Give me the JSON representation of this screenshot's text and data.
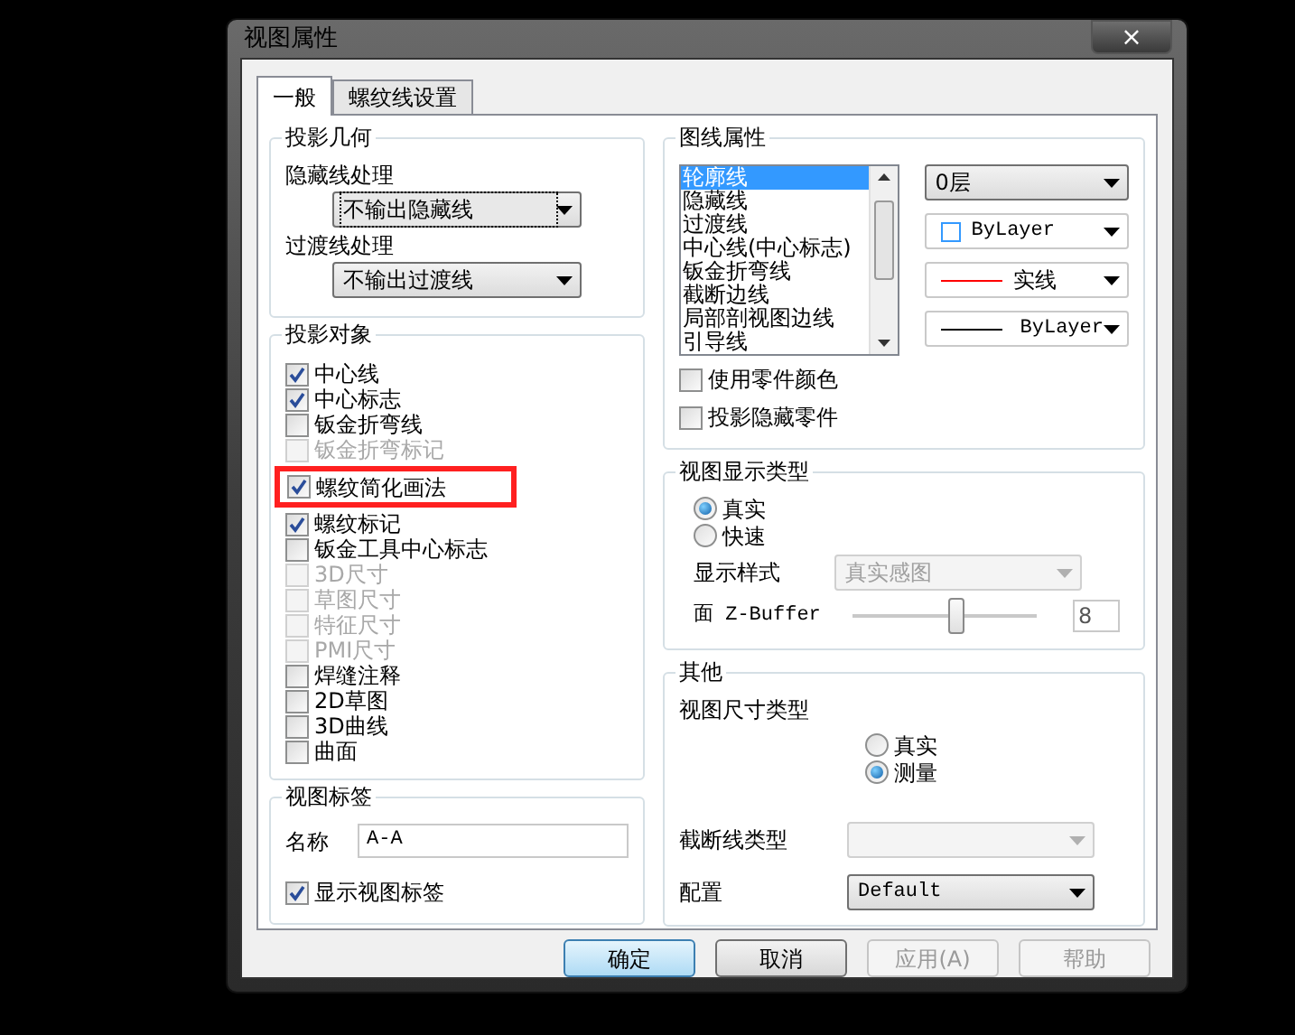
{
  "window": {
    "title": "视图属性",
    "close": "×"
  },
  "tabs": [
    {
      "label": "一般",
      "selected": true
    },
    {
      "label": "螺纹线设置",
      "selected": false
    }
  ],
  "geometry": {
    "title": "投影几何",
    "fields": [
      {
        "label": "隐藏线处理",
        "value": "不输出隐藏线",
        "focused": true
      },
      {
        "label": "过渡线处理",
        "value": "不输出过渡线",
        "focused": false
      }
    ]
  },
  "objects": {
    "title": "投影对象",
    "items": [
      {
        "label": "中心线",
        "checked": true,
        "disabled": false,
        "highlighted": false
      },
      {
        "label": "中心标志",
        "checked": true,
        "disabled": false,
        "highlighted": false
      },
      {
        "label": "钣金折弯线",
        "checked": false,
        "disabled": false,
        "highlighted": false
      },
      {
        "label": "钣金折弯标记",
        "checked": false,
        "disabled": true,
        "highlighted": false
      },
      {
        "label": "螺纹简化画法",
        "checked": true,
        "disabled": false,
        "highlighted": true
      },
      {
        "label": "螺纹标记",
        "checked": true,
        "disabled": false,
        "highlighted": false
      },
      {
        "label": "钣金工具中心标志",
        "checked": false,
        "disabled": false,
        "highlighted": false
      },
      {
        "label": "3D尺寸",
        "checked": false,
        "disabled": true,
        "highlighted": false
      },
      {
        "label": "草图尺寸",
        "checked": false,
        "disabled": true,
        "highlighted": false
      },
      {
        "label": "特征尺寸",
        "checked": false,
        "disabled": true,
        "highlighted": false
      },
      {
        "label": "PMI尺寸",
        "checked": false,
        "disabled": true,
        "highlighted": false
      },
      {
        "label": "焊缝注释",
        "checked": false,
        "disabled": false,
        "highlighted": false
      },
      {
        "label": "2D草图",
        "checked": false,
        "disabled": false,
        "highlighted": false
      },
      {
        "label": "3D曲线",
        "checked": false,
        "disabled": false,
        "highlighted": false
      },
      {
        "label": "曲面",
        "checked": false,
        "disabled": false,
        "highlighted": false
      }
    ]
  },
  "view_label": {
    "title": "视图标签",
    "name_label": "名称",
    "name_value": "A-A",
    "show": {
      "label": "显示视图标签",
      "checked": true
    }
  },
  "line_props": {
    "title": "图线属性",
    "list": [
      {
        "label": "轮廓线",
        "selected": true
      },
      {
        "label": "隐藏线",
        "selected": false
      },
      {
        "label": "过渡线",
        "selected": false
      },
      {
        "label": "中心线(中心标志)",
        "selected": false
      },
      {
        "label": "钣金折弯线",
        "selected": false
      },
      {
        "label": "截断边线",
        "selected": false
      },
      {
        "label": "局部剖视图边线",
        "selected": false
      },
      {
        "label": "引导线",
        "selected": false
      }
    ],
    "layer": "0层",
    "color": {
      "value": "ByLayer",
      "color": "#3399ff"
    },
    "linetype": {
      "value": "实线",
      "color": "#ff0000"
    },
    "lineweight": {
      "value": "ByLayer"
    },
    "checkboxes": [
      {
        "label": "使用零件颜色",
        "checked": false
      },
      {
        "label": "投影隐藏零件",
        "checked": false
      }
    ]
  },
  "display_type": {
    "title": "视图显示类型",
    "radios": [
      {
        "label": "真实",
        "selected": true
      },
      {
        "label": "快速",
        "selected": false
      }
    ],
    "style_label": "显示样式",
    "style_value": "真实感图",
    "zbuffer_label": "面 Z-Buffer",
    "zbuffer": {
      "level": 0.56,
      "value": "8"
    }
  },
  "other": {
    "title": "其他",
    "dim_label": "视图尺寸类型",
    "radios": [
      {
        "label": "真实",
        "selected": false
      },
      {
        "label": "测量",
        "selected": true
      }
    ],
    "break_label": "截断线类型",
    "config_label": "配置",
    "config_value": "Default"
  },
  "buttons": [
    {
      "label": "确定",
      "disabled": false,
      "default": true
    },
    {
      "label": "取消",
      "disabled": false,
      "default": false
    },
    {
      "label": "应用(A)",
      "disabled": true,
      "default": false
    },
    {
      "label": "帮助",
      "disabled": true,
      "default": false
    }
  ]
}
